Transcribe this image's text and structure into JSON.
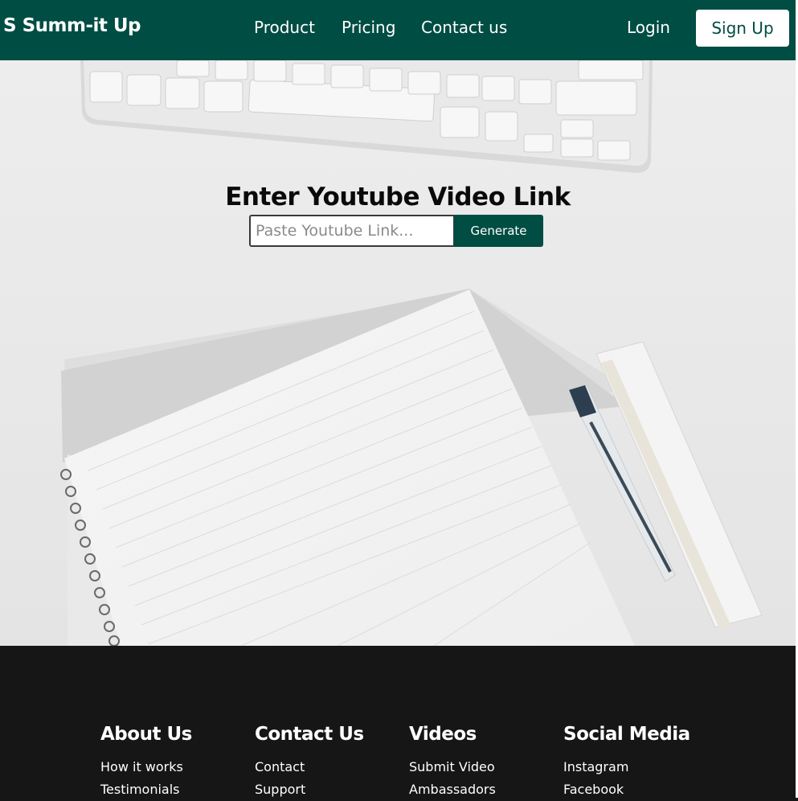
{
  "navbar": {
    "brand": "S Summ-it Up",
    "links": {
      "product": "Product",
      "pricing": "Pricing",
      "contact": "Contact us"
    },
    "login": "Login",
    "signup": "Sign Up",
    "color": "#004d43"
  },
  "hero": {
    "title": "Enter Youtube Video Link",
    "input_placeholder": "Paste Youtube Link...",
    "input_value": "",
    "generate_label": "Generate",
    "background_image": "desk-with-keyboard-notebook-pen-ruler"
  },
  "footer": {
    "columns": [
      {
        "heading": "About Us",
        "links": [
          "How it works",
          "Testimonials"
        ]
      },
      {
        "heading": "Contact Us",
        "links": [
          "Contact",
          "Support"
        ]
      },
      {
        "heading": "Videos",
        "links": [
          "Submit Video",
          "Ambassadors"
        ]
      },
      {
        "heading": "Social Media",
        "links": [
          "Instagram",
          "Facebook"
        ]
      }
    ],
    "background": "#161616"
  }
}
